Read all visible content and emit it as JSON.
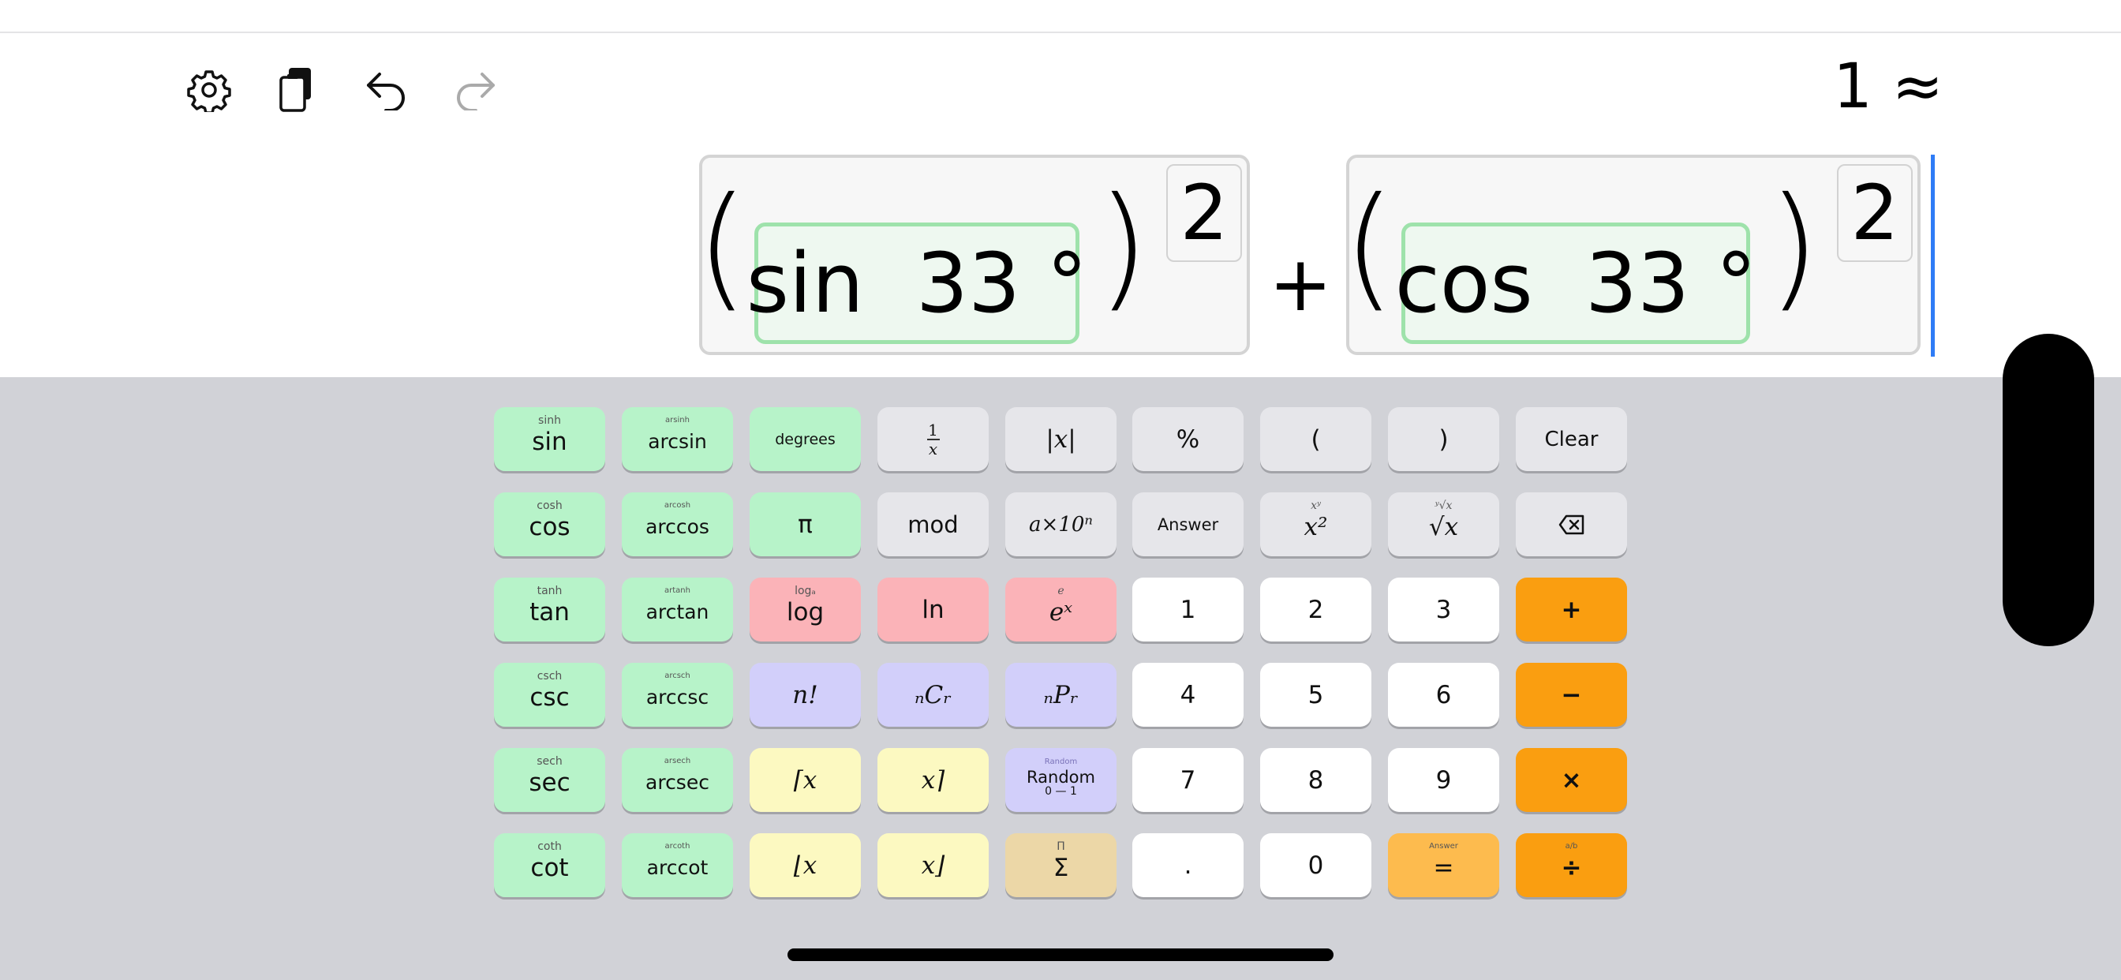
{
  "toolbar": {
    "settings_icon": "gear-icon",
    "copy_icon": "copy-icon",
    "undo_icon": "undo-icon",
    "redo_icon": "redo-icon"
  },
  "result": "1 ≈",
  "expression": {
    "term1": {
      "func": "sin  33 °",
      "exponent": "2"
    },
    "operator": "+",
    "term2": {
      "func": "cos  33 °",
      "exponent": "2"
    },
    "open_paren": "(",
    "close_paren": ")"
  },
  "keys": {
    "r1": {
      "sin": {
        "main": "sin",
        "sub": "sinh"
      },
      "arcsin": {
        "main": "arcsin",
        "sub": "arsinh"
      },
      "degrees": {
        "main": "degrees"
      },
      "reciprocal": {
        "num": "1",
        "den": "x"
      },
      "abs": {
        "main": "|x|"
      },
      "percent": {
        "main": "%"
      },
      "lparen": {
        "main": "("
      },
      "rparen": {
        "main": ")"
      },
      "clear": {
        "main": "Clear"
      }
    },
    "r2": {
      "cos": {
        "main": "cos",
        "sub": "cosh"
      },
      "arccos": {
        "main": "arccos",
        "sub": "arcosh"
      },
      "pi": {
        "main": "π"
      },
      "mod": {
        "main": "mod"
      },
      "sci": {
        "main": "a×10ⁿ"
      },
      "answer": {
        "main": "Answer"
      },
      "square": {
        "main": "x²",
        "sub": "xʸ"
      },
      "sqrt": {
        "main": "√x",
        "sub": "ʸ√x"
      },
      "backspace": {
        "main": "⌫"
      }
    },
    "r3": {
      "tan": {
        "main": "tan",
        "sub": "tanh"
      },
      "arctan": {
        "main": "arctan",
        "sub": "artanh"
      },
      "log": {
        "main": "log",
        "sub": "logₐ"
      },
      "ln": {
        "main": "ln"
      },
      "exp": {
        "main": "eˣ",
        "sub": "e"
      },
      "one": {
        "main": "1"
      },
      "two": {
        "main": "2"
      },
      "three": {
        "main": "3"
      },
      "plus": {
        "main": "+"
      }
    },
    "r4": {
      "csc": {
        "main": "csc",
        "sub": "csch"
      },
      "arccsc": {
        "main": "arccsc",
        "sub": "arcsch"
      },
      "factorial": {
        "main": "n!"
      },
      "ncr": {
        "main": "ₙCᵣ"
      },
      "npr": {
        "main": "ₙPᵣ"
      },
      "four": {
        "main": "4"
      },
      "five": {
        "main": "5"
      },
      "six": {
        "main": "6"
      },
      "minus": {
        "main": "−"
      }
    },
    "r5": {
      "sec": {
        "main": "sec",
        "sub": "sech"
      },
      "arcsec": {
        "main": "arcsec",
        "sub": "arsech"
      },
      "ceil_left": {
        "main": "⌈x"
      },
      "ceil_right": {
        "main": "x⌉"
      },
      "random": {
        "main": "Random",
        "sub": "Random",
        "range": "0 — 1"
      },
      "seven": {
        "main": "7"
      },
      "eight": {
        "main": "8"
      },
      "nine": {
        "main": "9"
      },
      "times": {
        "main": "×"
      }
    },
    "r6": {
      "cot": {
        "main": "cot",
        "sub": "coth"
      },
      "arccot": {
        "main": "arccot",
        "sub": "arcoth"
      },
      "floor_left": {
        "main": "⌊x"
      },
      "floor_right": {
        "main": "x⌋"
      },
      "sum": {
        "main": "Σ",
        "sub": "Π"
      },
      "dot": {
        "main": "."
      },
      "zero": {
        "main": "0"
      },
      "equals": {
        "main": "=",
        "sub": "Answer"
      },
      "divide": {
        "main": "÷",
        "sub": "a/b"
      }
    }
  }
}
